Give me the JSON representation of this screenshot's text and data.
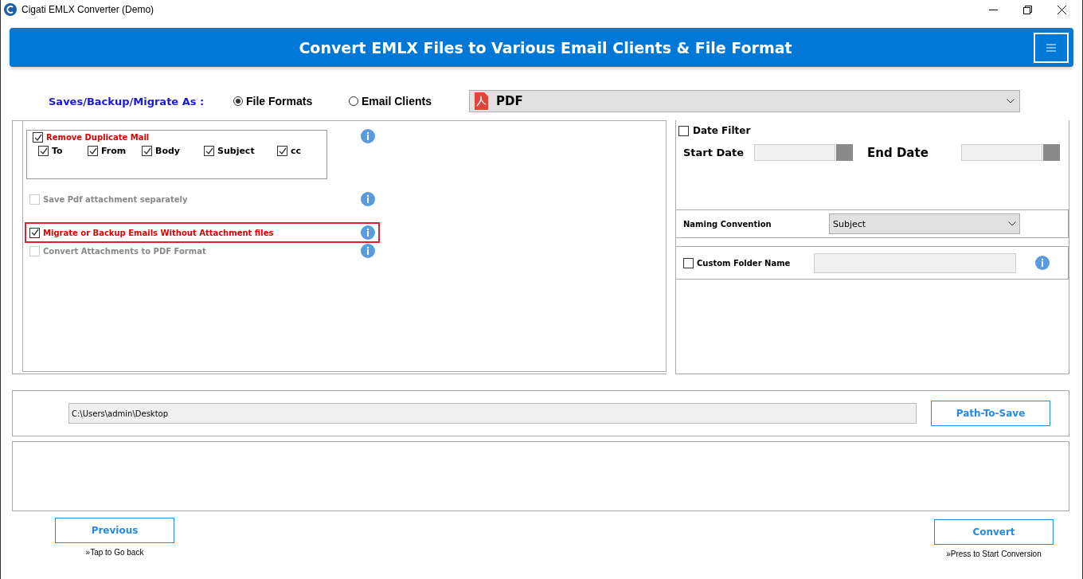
{
  "window": {
    "title": "Cigati EMLX Converter (Demo)"
  },
  "header": {
    "title": "Convert EMLX Files to Various Email Clients & File Format"
  },
  "save_as": {
    "label": "Saves/Backup/Migrate As :",
    "options": [
      {
        "label": "File Formats",
        "selected": true
      },
      {
        "label": "Email Clients",
        "selected": false
      }
    ],
    "format": "PDF"
  },
  "duplicate": {
    "label": "Remove Duplicate Mail",
    "checked": true,
    "fields": [
      {
        "label": "To",
        "checked": true
      },
      {
        "label": "From",
        "checked": true
      },
      {
        "label": "Body",
        "checked": true
      },
      {
        "label": "Subject",
        "checked": true
      },
      {
        "label": "cc",
        "checked": true
      }
    ]
  },
  "options": [
    {
      "label": "Save Pdf attachment separately",
      "checked": false,
      "disabled": true,
      "highlighted": false
    },
    {
      "label": "Migrate or Backup Emails Without Attachment files",
      "checked": true,
      "disabled": false,
      "highlighted": true
    },
    {
      "label": "Convert Attachments to PDF Format",
      "checked": false,
      "disabled": true,
      "highlighted": false
    }
  ],
  "date_filter": {
    "label": "Date Filter",
    "checked": false,
    "start_label": "Start Date",
    "end_label": "End Date"
  },
  "naming": {
    "label": "Naming Convention",
    "value": "Subject"
  },
  "custom_folder": {
    "label": "Custom Folder Name",
    "checked": false
  },
  "path": {
    "value": "C:\\Users\\admin\\Desktop",
    "button": "Path-To-Save"
  },
  "previous": {
    "label": "Previous",
    "hint": "»Tap to Go back"
  },
  "convert": {
    "label": "Convert",
    "hint": "»Press to Start Conversion"
  }
}
